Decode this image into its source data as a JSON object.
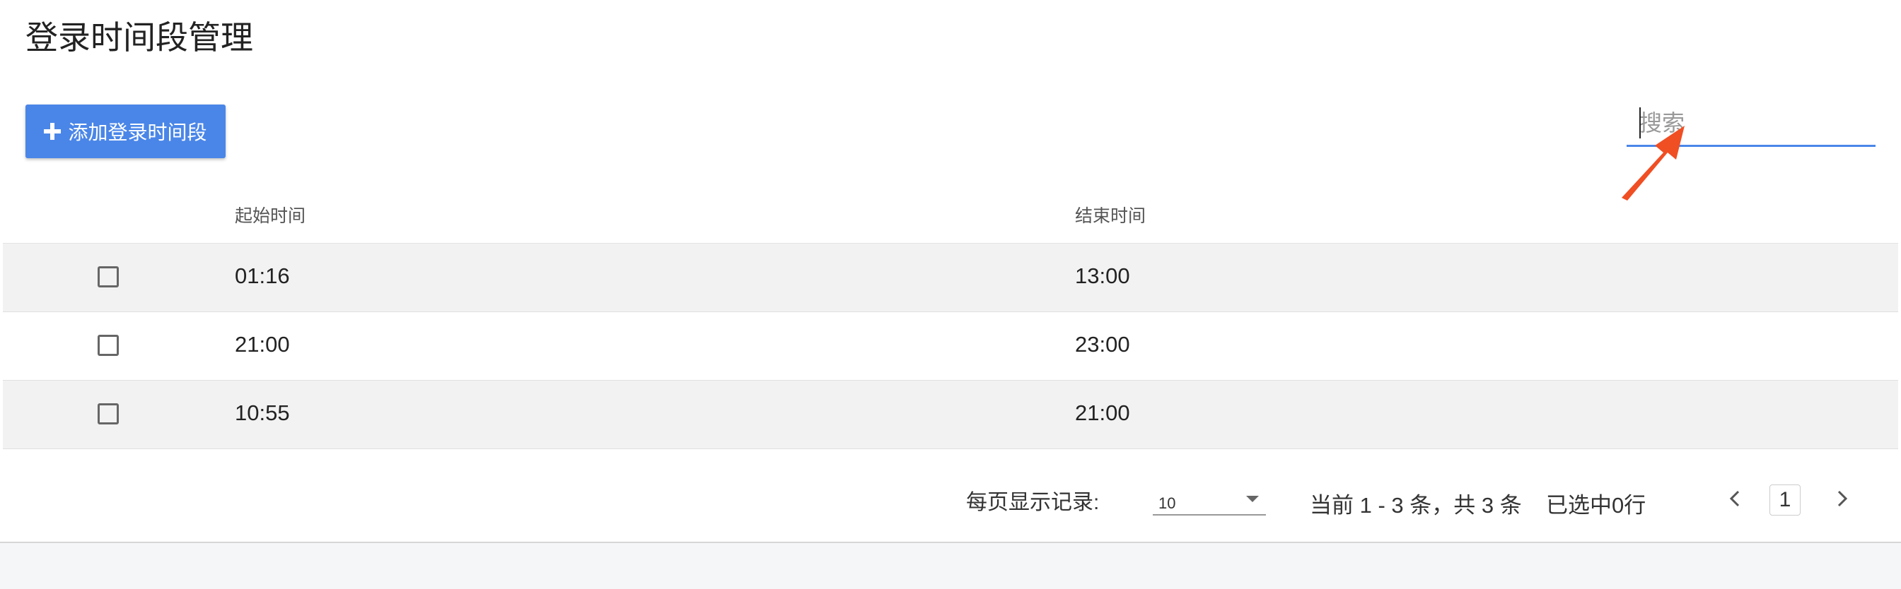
{
  "page": {
    "title": "登录时间段管理"
  },
  "toolbar": {
    "add_label": "添加登录时间段",
    "add_icon": "plus-icon"
  },
  "search": {
    "placeholder": "搜索",
    "value": "",
    "underline_color": "#4a86e8"
  },
  "table": {
    "columns": [
      "起始时间",
      "结束时间"
    ],
    "rows": [
      {
        "checked": false,
        "start": "01:16",
        "end": "13:00"
      },
      {
        "checked": false,
        "start": "21:00",
        "end": "23:00"
      },
      {
        "checked": false,
        "start": "10:55",
        "end": "21:00"
      }
    ]
  },
  "pagination": {
    "per_page_label": "每页显示记录:",
    "per_page_value": "10",
    "range_text": "当前 1 - 3 条，共 3 条",
    "selected_text": "已选中0行",
    "current_page": "1",
    "prev_icon": "chevron-left-icon",
    "next_icon": "chevron-right-icon"
  },
  "colors": {
    "accent": "#4a86e8",
    "annotation_arrow": "#f04e23",
    "row_shade": "#f2f2f2"
  }
}
